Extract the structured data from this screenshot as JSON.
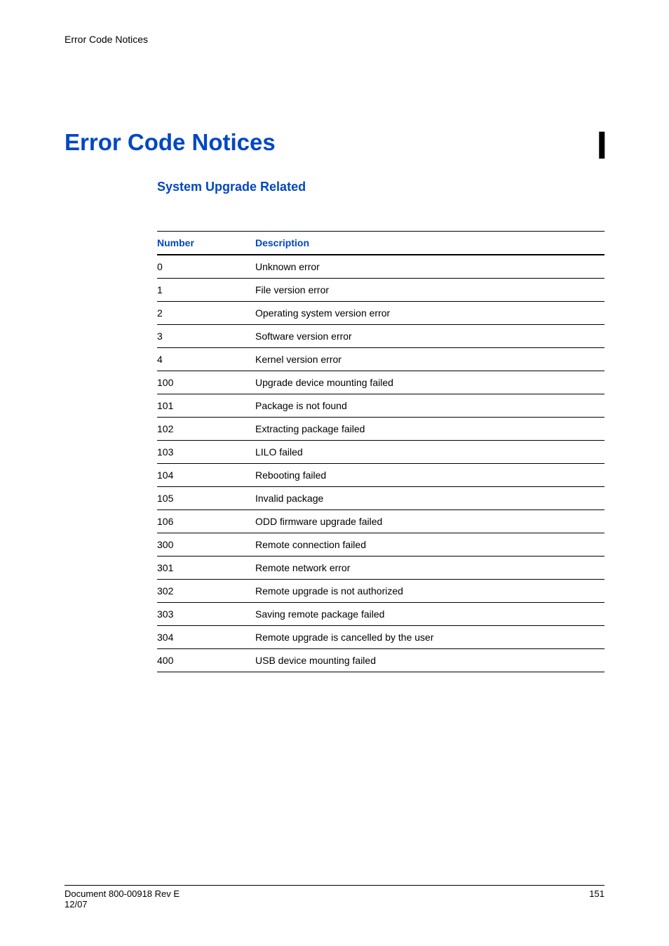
{
  "running_header": "Error Code Notices",
  "appendix_letter": "I",
  "main_title": "Error Code Notices",
  "section_title": "System Upgrade Related",
  "table": {
    "headers": {
      "number": "Number",
      "description": "Description"
    },
    "rows": [
      {
        "number": "0",
        "description": "Unknown error"
      },
      {
        "number": "1",
        "description": "File version error"
      },
      {
        "number": "2",
        "description": "Operating system version error"
      },
      {
        "number": "3",
        "description": "Software version error"
      },
      {
        "number": "4",
        "description": "Kernel version error"
      },
      {
        "number": "100",
        "description": "Upgrade device mounting failed"
      },
      {
        "number": "101",
        "description": "Package is not found"
      },
      {
        "number": "102",
        "description": "Extracting package failed"
      },
      {
        "number": "103",
        "description": "LILO failed"
      },
      {
        "number": "104",
        "description": "Rebooting failed"
      },
      {
        "number": "105",
        "description": "Invalid package"
      },
      {
        "number": "106",
        "description": "ODD firmware upgrade failed"
      },
      {
        "number": "300",
        "description": "Remote connection failed"
      },
      {
        "number": "301",
        "description": "Remote network error"
      },
      {
        "number": "302",
        "description": "Remote upgrade is not authorized"
      },
      {
        "number": "303",
        "description": "Saving remote package failed"
      },
      {
        "number": "304",
        "description": "Remote upgrade is cancelled by the user"
      },
      {
        "number": "400",
        "description": "USB device mounting failed"
      }
    ]
  },
  "footer": {
    "doc_line1": "Document 800-00918 Rev E",
    "doc_line2": "12/07",
    "page_number": "151"
  }
}
